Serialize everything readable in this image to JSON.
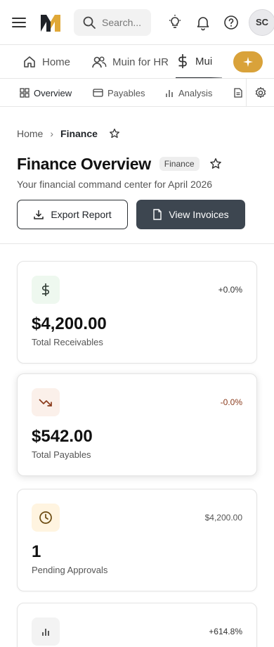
{
  "header": {
    "search_placeholder": "Search...",
    "avatar_initials": "SC"
  },
  "app_tabs": [
    {
      "label": "Home",
      "icon": "home-icon"
    },
    {
      "label": "Muin for HR",
      "icon": "users-icon"
    },
    {
      "label": "Mui",
      "icon": "dollar-icon",
      "active": true
    }
  ],
  "sub_tabs": [
    {
      "label": "Overview",
      "icon": "grid-icon",
      "active": true
    },
    {
      "label": "Payables",
      "icon": "card-icon"
    },
    {
      "label": "Analysis",
      "icon": "bar-chart-icon"
    }
  ],
  "breadcrumb": {
    "root": "Home",
    "current": "Finance"
  },
  "page": {
    "title": "Finance Overview",
    "badge": "Finance",
    "subtitle": "Your financial command center for April 2026"
  },
  "actions": {
    "export_label": "Export Report",
    "invoices_label": "View Invoices"
  },
  "stats": [
    {
      "value": "$4,200.00",
      "label": "Total Receivables",
      "change": "+0.0%",
      "icon": "dollar-icon",
      "icon_bg": "#eef8ef",
      "icon_color": "#2e3a33"
    },
    {
      "value": "$542.00",
      "label": "Total Payables",
      "change": "-0.0%",
      "icon": "trending-down-icon",
      "icon_bg": "#fbf0ea",
      "icon_color": "#8a3b1c"
    },
    {
      "value": "1",
      "label": "Pending Approvals",
      "change": "$4,200.00",
      "icon": "clock-icon",
      "icon_bg": "#fff4e0",
      "icon_color": "#6b4a10"
    },
    {
      "value": "",
      "label": "",
      "change": "+614.8%",
      "icon": "bar-chart-icon",
      "icon_bg": "#f3f3f3",
      "icon_color": "#333333"
    }
  ],
  "colors": {
    "accent_gold": "#d9a23a",
    "primary_button": "#3d4650",
    "payables_negative": "#8a3b1c"
  }
}
